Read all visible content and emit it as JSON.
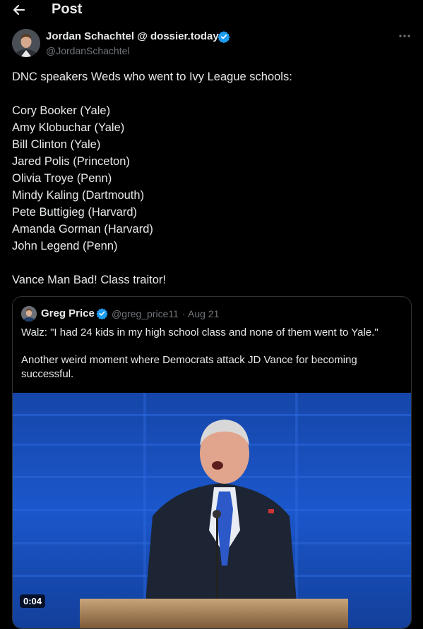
{
  "header": {
    "title": "Post"
  },
  "author": {
    "name": "Jordan Schachtel @ dossier.today",
    "handle": "@JordanSchachtel"
  },
  "tweet": {
    "intro": "DNC speakers Weds who went to Ivy League schools:",
    "speakers": [
      "Cory Booker (Yale)",
      "Amy Klobuchar (Yale)",
      "Bill Clinton (Yale)",
      "Jared Polis (Princeton)",
      "Olivia Troye (Penn)",
      "Mindy Kaling (Dartmouth)",
      "Pete Buttigieg (Harvard)",
      "Amanda Gorman (Harvard)",
      "John Legend (Penn)"
    ],
    "closing": "Vance Man Bad! Class traitor!"
  },
  "quote": {
    "name": "Greg Price",
    "handle": "@greg_price11",
    "separator": "·",
    "date": "Aug 21",
    "text_line1": "Walz: \"I had 24 kids in my high school class and none of them went to Yale.\"",
    "text_line2": "Another weird moment where Democrats attack JD Vance for becoming successful.",
    "video_duration": "0:04"
  },
  "icons": {
    "back": "arrow-left-icon",
    "verified": "verified-badge-icon",
    "more": "more-horizontal-icon"
  },
  "colors": {
    "background": "#000000",
    "text": "#e7e9ea",
    "muted": "#71767b",
    "verified": "#1d9bf0",
    "border": "#2f3336",
    "stage_blue": "#1a56c8"
  }
}
